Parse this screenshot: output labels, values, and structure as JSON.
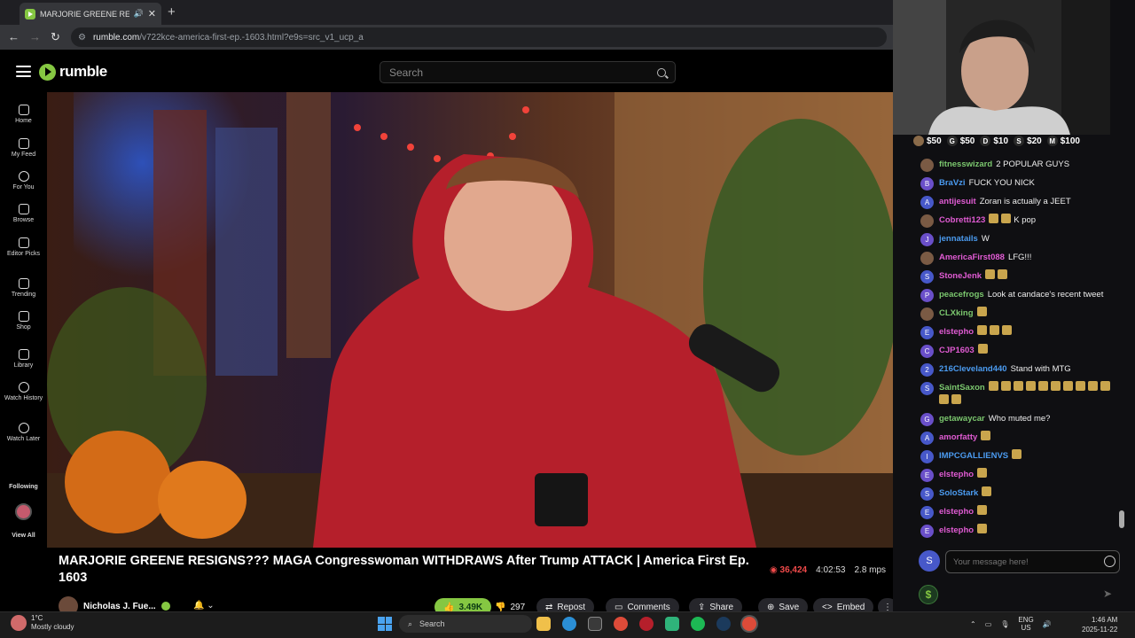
{
  "browser": {
    "tab_title": "MARJORIE GREENE RESIGNS",
    "new_tab_symbol": "+",
    "url_host": "rumble.com",
    "url_path": "/v722kce-america-first-ep.-1603.html?e9s=src_v1_ucp_a"
  },
  "header": {
    "logo_text": "rumble",
    "search_placeholder": "Search"
  },
  "sidebar": {
    "items": [
      {
        "label": "Home",
        "icon": "home-icon"
      },
      {
        "label": "My Feed",
        "icon": "feed-icon"
      },
      {
        "label": "For You",
        "icon": "for-you-icon"
      },
      {
        "label": "Browse",
        "icon": "browse-icon"
      },
      {
        "label": "Editor Picks",
        "icon": "editor-picks-icon"
      },
      {
        "label": "Trending",
        "icon": "trending-icon"
      },
      {
        "label": "Shop",
        "icon": "shop-icon"
      },
      {
        "label": "Library",
        "icon": "library-icon"
      },
      {
        "label": "Watch History",
        "icon": "history-icon"
      },
      {
        "label": "Watch Later",
        "icon": "clock-icon"
      }
    ],
    "following_label": "Following",
    "view_all_label": "View All"
  },
  "video": {
    "title": "MARJORIE GREENE RESIGNS??? MAGA Congresswoman WITHDRAWS After Trump ATTACK | America First Ep. 1603",
    "views": "36,424",
    "duration": "4:02:53",
    "bitrate": "2.8 mps",
    "channel_name": "Nicholas J. Fue...",
    "likes": "3.49K",
    "dislikes": "297",
    "actions": {
      "repost": "Repost",
      "comments": "Comments",
      "share": "Share",
      "save": "Save",
      "embed": "Embed"
    }
  },
  "chat": {
    "tips": [
      {
        "letter": "",
        "amount": "$50"
      },
      {
        "letter": "G",
        "amount": "$50"
      },
      {
        "letter": "D",
        "amount": "$10"
      },
      {
        "letter": "S",
        "amount": "$20"
      },
      {
        "letter": "M",
        "amount": "$100"
      }
    ],
    "messages": [
      {
        "initial": "",
        "user": "fitnesswizard",
        "color": "#7bc76e",
        "text": "2 POPULAR GUYS",
        "emotes": 0
      },
      {
        "initial": "B",
        "user": "BraVzi",
        "color": "#4b9bf0",
        "text": "FUCK YOU NICK",
        "emotes": 0
      },
      {
        "initial": "A",
        "user": "antijesuit",
        "color": "#e05bd3",
        "text": "Zoran is actually a JEET",
        "emotes": 0
      },
      {
        "initial": "",
        "user": "Cobretti123",
        "color": "#e05bd3",
        "text": "K pop",
        "emotes": 2
      },
      {
        "initial": "J",
        "user": "jennatails",
        "color": "#4b9bf0",
        "text": "W",
        "emotes": 0
      },
      {
        "initial": "",
        "user": "AmericaFirst088",
        "color": "#e05bd3",
        "text": "LFG!!!",
        "emotes": 0
      },
      {
        "initial": "S",
        "user": "StoneJenk",
        "color": "#e05bd3",
        "text": "",
        "emotes": 2
      },
      {
        "initial": "P",
        "user": "peacefrogs",
        "color": "#7bc76e",
        "text": "Look at candace's recent tweet",
        "emotes": 0
      },
      {
        "initial": "",
        "user": "CLXking",
        "color": "#7bc76e",
        "text": "",
        "emotes": 1
      },
      {
        "initial": "E",
        "user": "elstepho",
        "color": "#e05bd3",
        "text": "",
        "emotes": 3
      },
      {
        "initial": "C",
        "user": "CJP1603",
        "color": "#e05bd3",
        "text": "",
        "emotes": 1
      },
      {
        "initial": "2",
        "user": "216Cleveland440",
        "color": "#4b9bf0",
        "text": "Stand with MTG",
        "emotes": 0
      },
      {
        "initial": "S",
        "user": "SaintSaxon",
        "color": "#7bc76e",
        "text": "",
        "emotes": 12
      },
      {
        "initial": "G",
        "user": "getawaycar",
        "color": "#7bc76e",
        "text": "Who muted me?",
        "emotes": 0
      },
      {
        "initial": "A",
        "user": "amorfatty",
        "color": "#e05bd3",
        "text": "",
        "emotes": 1
      },
      {
        "initial": "I",
        "user": "IMPCGALLIENVS",
        "color": "#4b9bf0",
        "text": "",
        "emotes": 1
      },
      {
        "initial": "E",
        "user": "elstepho",
        "color": "#e05bd3",
        "text": "",
        "emotes": 1
      },
      {
        "initial": "S",
        "user": "SoloStark",
        "color": "#4b9bf0",
        "text": "",
        "emotes": 1
      },
      {
        "initial": "E",
        "user": "elstepho",
        "color": "#e05bd3",
        "text": "",
        "emotes": 1
      },
      {
        "initial": "E",
        "user": "elstepho",
        "color": "#e05bd3",
        "text": "",
        "emotes": 1
      }
    ],
    "input_avatar": "S",
    "input_placeholder": "Your message here!",
    "dollar_symbol": "$"
  },
  "taskbar": {
    "temperature": "1°C",
    "weather": "Mostly cloudy",
    "search_label": "Search",
    "lang_top": "ENG",
    "lang_bottom": "US",
    "time": "1:46 AM",
    "date": "2025-11-22"
  }
}
